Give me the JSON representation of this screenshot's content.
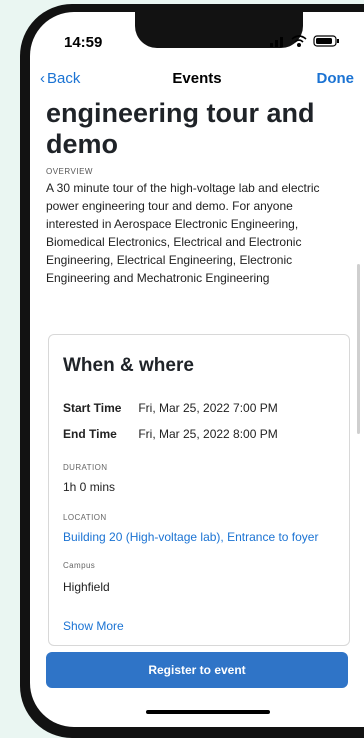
{
  "status": {
    "time": "14:59"
  },
  "nav": {
    "back_label": "Back",
    "title": "Events",
    "done_label": "Done"
  },
  "event": {
    "title": "engineering tour and demo",
    "overview_label": "OVERVIEW",
    "overview_text": "A 30 minute tour of the high-voltage lab and electric power engineering tour and demo. For anyone interested in Aerospace Electronic Engineering, Biomedical Electronics, Electrical and Electronic Engineering, Electrical Engineering, Electronic Engineering and Mechatronic Engineering"
  },
  "when_where": {
    "heading": "When & where",
    "start_label": "Start Time",
    "start_value": "Fri, Mar 25, 2022 7:00 PM",
    "end_label": "End Time",
    "end_value": "Fri, Mar 25, 2022 8:00 PM",
    "duration_label": "DURATION",
    "duration_value": "1h 0 mins",
    "location_label": "LOCATION",
    "location_value": "Building 20 (High-voltage lab), Entrance to foyer",
    "campus_label": "Campus",
    "campus_value": "Highfield",
    "show_more_label": "Show More"
  },
  "register_label": "Register to event",
  "colors": {
    "accent": "#1b73d3",
    "button": "#2f74c7"
  }
}
